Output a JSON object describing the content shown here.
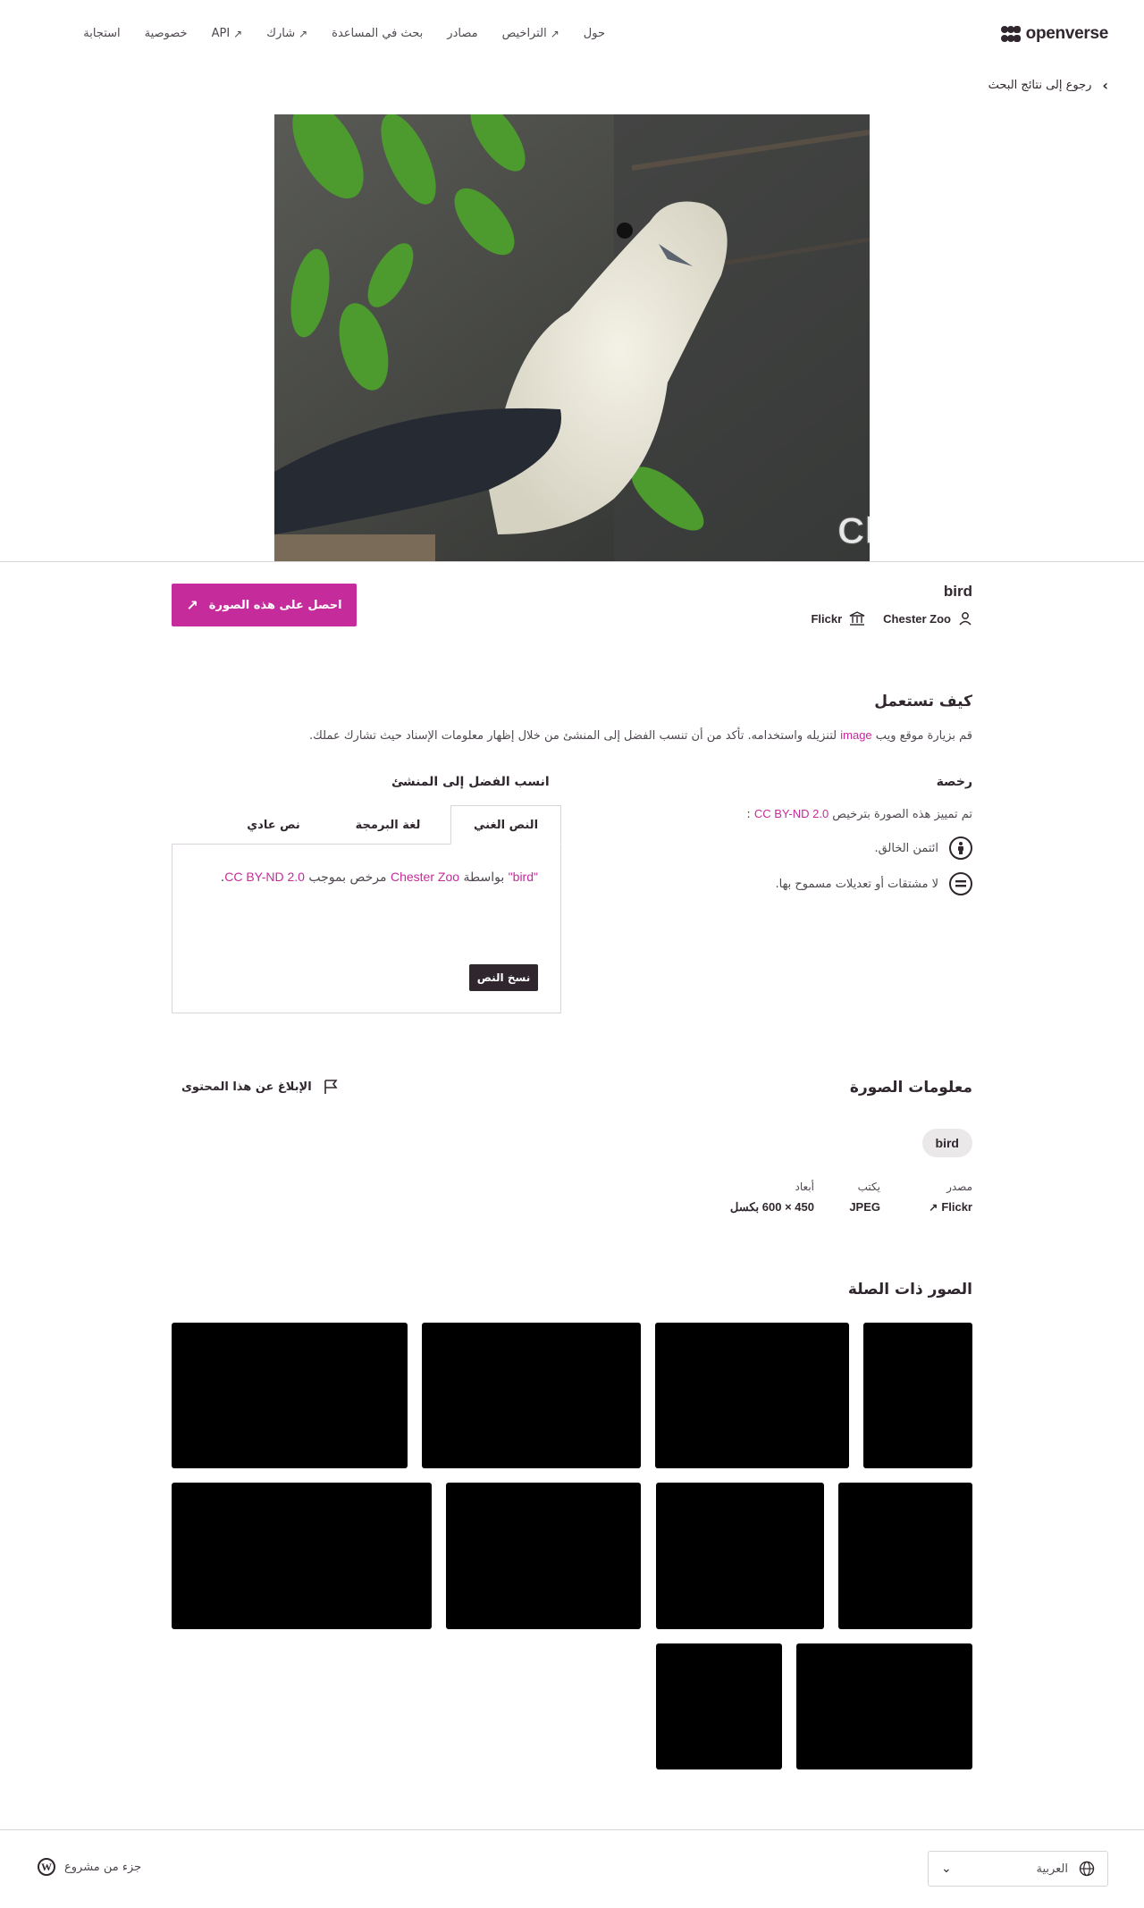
{
  "header": {
    "logo_text": "openverse",
    "nav": [
      {
        "label": "حول",
        "external": false
      },
      {
        "label": "التراخيص",
        "external": true
      },
      {
        "label": "مصادر",
        "external": false
      },
      {
        "label": "بحث في المساعدة",
        "external": false
      },
      {
        "label": "شارك",
        "external": true
      },
      {
        "label": "API",
        "external": true
      },
      {
        "label": "خصوصية",
        "external": false
      },
      {
        "label": "استجابة",
        "external": false
      }
    ],
    "back_label": "رجوع إلى نتائج البحث"
  },
  "image": {
    "watermark": "ChesterZoo.org",
    "title": "bird",
    "creator": "Chester Zoo",
    "source": "Flickr",
    "get_button": "احصل على هذه الصورة"
  },
  "usage": {
    "heading": "كيف تستعمل",
    "description_prefix": "قم بزيارة موقع ويب ",
    "description_link": "image",
    "description_suffix": " لتنزيله واستخدامه. تأكد من أن تنسب الفضل إلى المنشئ من خلال إظهار معلومات الإسناد حيث تشارك عملك.",
    "license_heading": "رخصة",
    "license_text_prefix": "تم تمييز هذه الصورة بترخيص ",
    "license_name": "CC BY-ND 2.0",
    "license_text_suffix": " :",
    "conditions": [
      {
        "icon": "by-icon",
        "text": "ائتمن الخالق."
      },
      {
        "icon": "nd-icon",
        "text": "لا مشتقات أو تعديلات مسموح بها."
      }
    ]
  },
  "attribution": {
    "heading": "انسب الفضل إلى المنشئ",
    "tabs": [
      "النص الغني",
      "لغة البرمجة",
      "نص عادي"
    ],
    "active_tab": 0,
    "title_quoted": "\"bird\"",
    "by": " بواسطة ",
    "creator": "Chester Zoo",
    "licensed": " مرخص بموجب ",
    "license": "CC BY-ND 2.0",
    "end": ".",
    "copy_button": "نسخ النص"
  },
  "info": {
    "heading": "معلومات الصورة",
    "report": "الإبلاغ عن هذا المحتوى",
    "tag": "bird",
    "source_label": "مصدر",
    "source_value": "Flickr",
    "type_label": "يكتب",
    "type_value": "JPEG",
    "dims_label": "أبعاد",
    "dims_value": "450 × 600 بكسل"
  },
  "related": {
    "heading": "الصور ذات الصلة"
  },
  "footer": {
    "wp_text": "جزء من مشروع",
    "language": "العربية"
  }
}
